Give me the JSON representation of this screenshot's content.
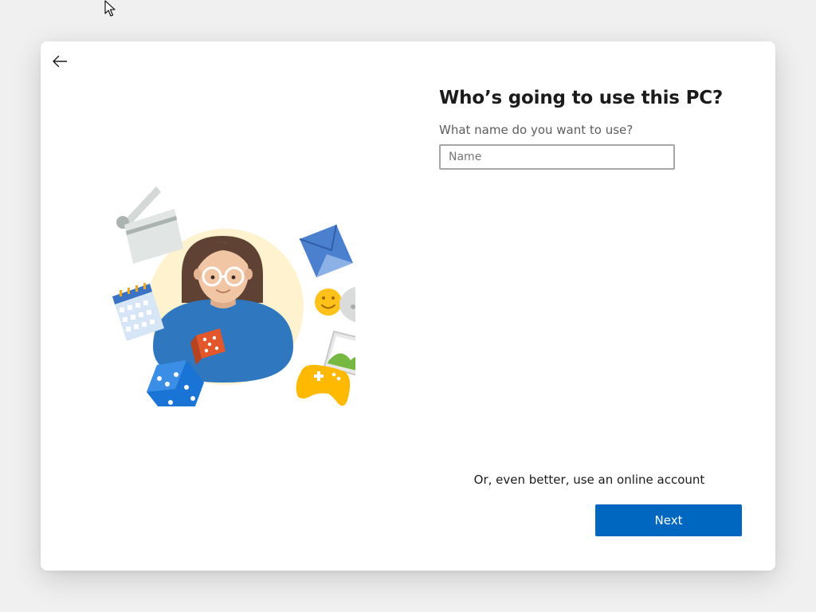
{
  "page": {
    "title": "Who’s going to use this PC?",
    "subtitle": "What name do you want to use?"
  },
  "name_field": {
    "value": "",
    "placeholder": "Name"
  },
  "online_account_link": "Or, even better, use an online account",
  "buttons": {
    "next_label": "Next"
  },
  "icons": {
    "back": "back-arrow-icon",
    "cursor": "mouse-pointer-icon"
  },
  "colors": {
    "accent": "#0067c0",
    "background": "#f0f0f0",
    "card": "#ffffff",
    "title_text": "#1b1b1b",
    "subtitle_text": "#5d5d5d",
    "input_border": "#a6a6a6"
  }
}
